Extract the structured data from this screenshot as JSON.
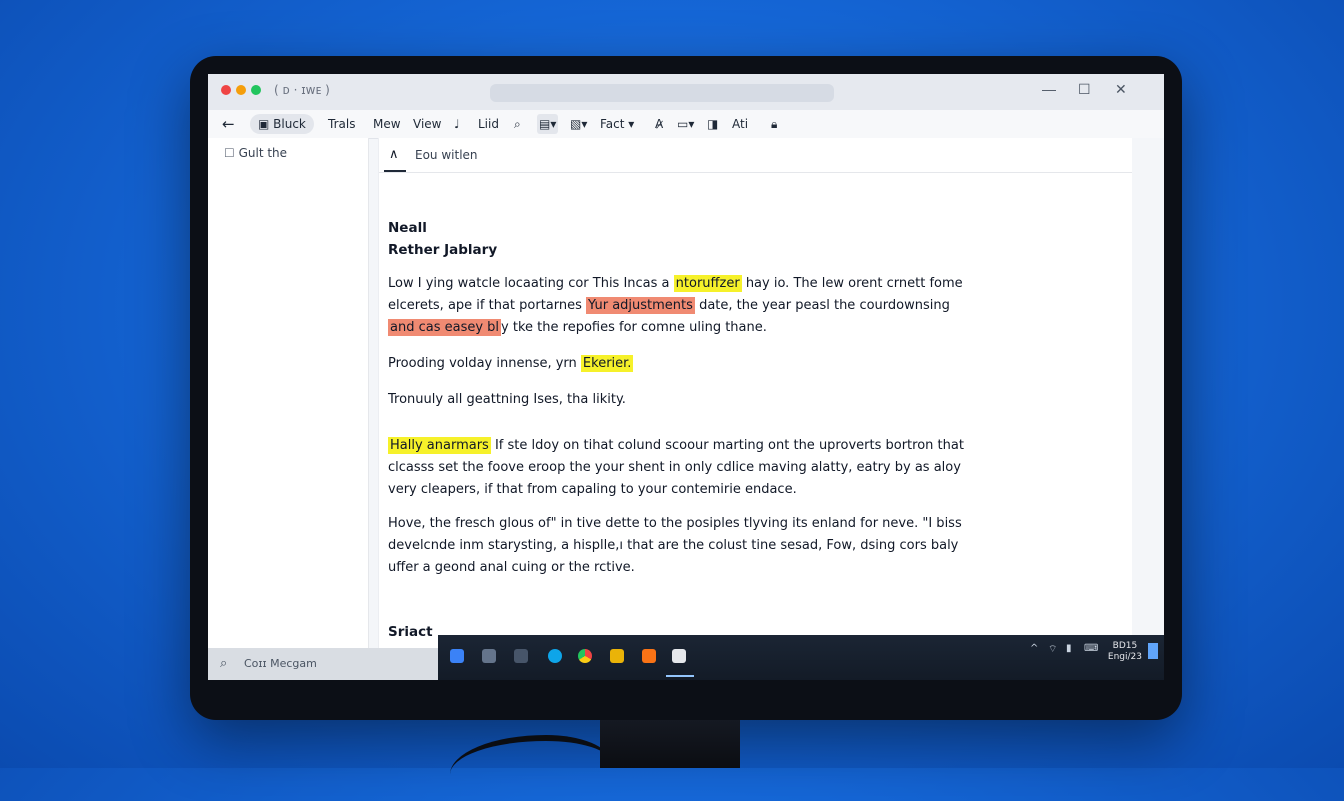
{
  "window": {
    "title": "( ᴅ ·  ɪᴡᴇ )",
    "controls": [
      "—",
      "☐",
      "✕"
    ]
  },
  "toolbar": {
    "back": "←",
    "items": [
      "Bluck",
      "Trals",
      "Mew",
      "View",
      "Liid",
      "Fact",
      "Ati"
    ]
  },
  "sidebar": {
    "item_label": "Gult the"
  },
  "document": {
    "tab_label": "Eou witlen",
    "heading1": "Neall",
    "heading2": "Rether Jablary",
    "p1": {
      "l1a": "Low I ying watcle locaating cor This Incas a",
      "l1h": "ntoruffzer",
      "l1b": "hay io. The lew orent crnett fome",
      "l2a": "elcerets, ape if that portarnes",
      "l2h": "Yur adjustments",
      "l2b": "date, the year peasl the courdownsing",
      "l3h": "and cas easey bl",
      "l3b": "y tke the repofies for comne uling thane."
    },
    "p2": {
      "a": "Prooding volday innense, yrn",
      "h": "Ekerier."
    },
    "p3": "Tronuuly all geattning Ises, tha likity.",
    "p4": {
      "h": "Hally anarmars",
      "l1": "If ste ldoy on tihat colund scoour marting ont the uproverts bortron that",
      "l2": "clcasss set the foove eroop the your shent in only cdlice maving alatty, eatry by as aloy",
      "l3": "very cleapers, if that from capaling to your contemirie endace."
    },
    "p5": {
      "l1": "Hove, the fresch glous of\" in tive dette to the posiples tlyving its enland for neve. \"I biss",
      "l2": "develcnde inm starysting, a hisplle,ı that are the colust tine sesad, Fow, dsing cors baly",
      "l3": "uffer a geond anal cuing or the rctive."
    },
    "footer_heading": "Sriact"
  },
  "statusbar": {
    "search_text": "Coɪɪ Mecgam"
  },
  "taskbar": {
    "clock_line1": "BD15",
    "clock_line2": "Engi/23"
  },
  "colors": {
    "highlight_yellow": "#f6f12a",
    "highlight_red": "#f08a72",
    "close_dot": "#ef4444",
    "min_dot": "#f59e0b",
    "max_dot": "#22c55e"
  }
}
